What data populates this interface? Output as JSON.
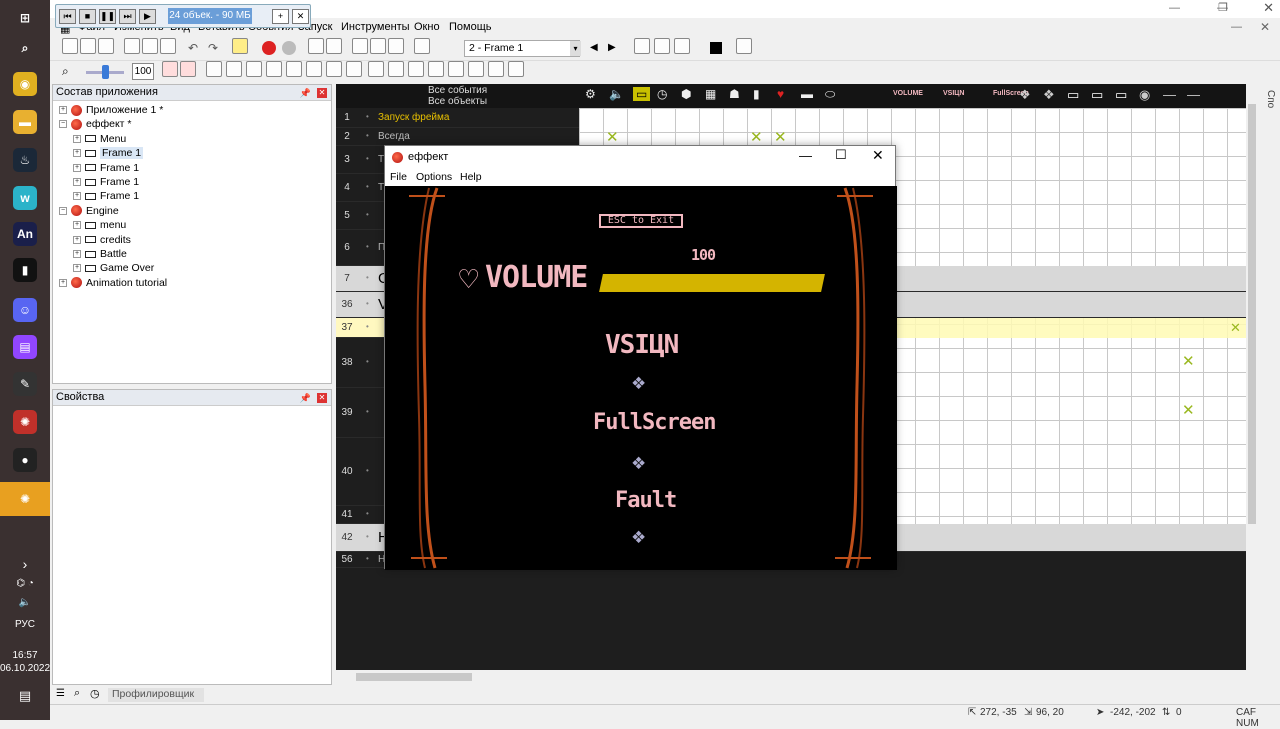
{
  "taskbar": {
    "language": "РУС",
    "time": "16:57",
    "date": "06.10.2022",
    "apps": [
      {
        "name": "chrome-icon",
        "color": "#e0b020",
        "glyph": "◉"
      },
      {
        "name": "folder-icon",
        "color": "#e8b030",
        "glyph": "▬"
      },
      {
        "name": "steam-icon",
        "color": "#1b2838",
        "glyph": "♨"
      },
      {
        "name": "w-app-icon",
        "color": "#2bb3c9",
        "glyph": "w"
      },
      {
        "name": "animate-icon",
        "color": "#1a1f4a",
        "glyph": "An"
      },
      {
        "name": "terminal-icon",
        "color": "#111",
        "glyph": "▮"
      },
      {
        "name": "discord-icon",
        "color": "#5865f2",
        "glyph": "☺"
      },
      {
        "name": "twitch-icon",
        "color": "#9146ff",
        "glyph": "▤"
      },
      {
        "name": "pen-icon",
        "color": "#333",
        "glyph": "✎"
      },
      {
        "name": "fusion-icon",
        "color": "#c0302a",
        "glyph": "✺"
      },
      {
        "name": "record-icon",
        "color": "#222",
        "glyph": "●"
      },
      {
        "name": "fusion-active-icon",
        "color": "#e05020",
        "glyph": "✺"
      }
    ]
  },
  "player": {
    "info": "24 объек. - 90 МБ"
  },
  "menu": [
    "Файл",
    "Изменить",
    "Вид",
    "Вставить",
    "События",
    "Запуск",
    "Инструменты",
    "Окно",
    "Помощь"
  ],
  "toolbar": {
    "frame_select": "2 - Frame 1",
    "zoom": "100"
  },
  "workspace": {
    "title": "Состав приложения",
    "tree": [
      {
        "label": "Приложение 1 *",
        "type": "app",
        "level": 0,
        "exp": "+"
      },
      {
        "label": "еффект *",
        "type": "app",
        "level": 0,
        "exp": "−"
      },
      {
        "label": "Menu",
        "type": "frame",
        "level": 1,
        "exp": "+"
      },
      {
        "label": "Frame 1",
        "type": "frame",
        "level": 1,
        "exp": "+",
        "selected": true
      },
      {
        "label": "Frame 1",
        "type": "frame",
        "level": 1,
        "exp": "+"
      },
      {
        "label": "Frame 1",
        "type": "frame",
        "level": 1,
        "exp": "+"
      },
      {
        "label": "Frame 1",
        "type": "frame",
        "level": 1,
        "exp": "+"
      },
      {
        "label": "Engine",
        "type": "app",
        "level": 0,
        "exp": "−"
      },
      {
        "label": "menu",
        "type": "frame",
        "level": 1,
        "exp": "+"
      },
      {
        "label": "credits",
        "type": "frame",
        "level": 1,
        "exp": "+"
      },
      {
        "label": "Battle",
        "type": "frame",
        "level": 1,
        "exp": "+"
      },
      {
        "label": "Game Over",
        "type": "frame",
        "level": 1,
        "exp": "+"
      },
      {
        "label": "Animation tutorial",
        "type": "app",
        "level": 0,
        "exp": "+"
      }
    ]
  },
  "properties": {
    "title": "Свойства"
  },
  "editor": {
    "header_all_events": "Все события",
    "header_all_objects": "Все объекты",
    "rows": [
      {
        "num": "1",
        "text": "Запуск фрейма",
        "style": "cond"
      },
      {
        "num": "2",
        "text": "Всегда",
        "style": "plain"
      },
      {
        "num": "3",
        "text": "T",
        "style": "plain"
      },
      {
        "num": "4",
        "text": "T",
        "style": "plain"
      },
      {
        "num": "5",
        "text": "",
        "style": "plain"
      },
      {
        "num": "6",
        "text": "П",
        "style": "plain"
      },
      {
        "num": "7",
        "text": "Gl",
        "style": "group"
      },
      {
        "num": "36",
        "text": "Vo",
        "style": "group"
      },
      {
        "num": "37",
        "text": "",
        "style": "highlight"
      },
      {
        "num": "38",
        "text": "",
        "style": "plain"
      },
      {
        "num": "39",
        "text": "",
        "style": "plain"
      },
      {
        "num": "40",
        "text": "",
        "style": "plain"
      },
      {
        "num": "41",
        "text": "",
        "style": "plain"
      },
      {
        "num": "42",
        "text": "He",
        "style": "group"
      },
      {
        "num": "56",
        "text": "H",
        "style": "plain"
      }
    ],
    "object_labels": [
      "VOLUME",
      "VSIЦN",
      "FullScreen"
    ]
  },
  "game_window": {
    "title": "еффект",
    "menu": [
      "File",
      "Options",
      "Help"
    ],
    "esc_label": "ESC to Exit",
    "volume_label": "VOLUME",
    "volume_value": "100",
    "volume_level": 1.0,
    "vsync_label": "VSIЦN",
    "fullscreen_label": "FullScreen",
    "fault_label": "Fault"
  },
  "bottom": {
    "profiler": "Профилировщик"
  },
  "status": {
    "coord1": "272, -35",
    "coord2": "96, 20",
    "coord3": "-242, -202",
    "count": "0",
    "caps": "CAF NUM"
  },
  "colors": {
    "accent_yellow": "#e0c000",
    "game_pink": "#f2b8c0",
    "frame_orange": "#c0501a",
    "tick_green": "#9ab820"
  }
}
